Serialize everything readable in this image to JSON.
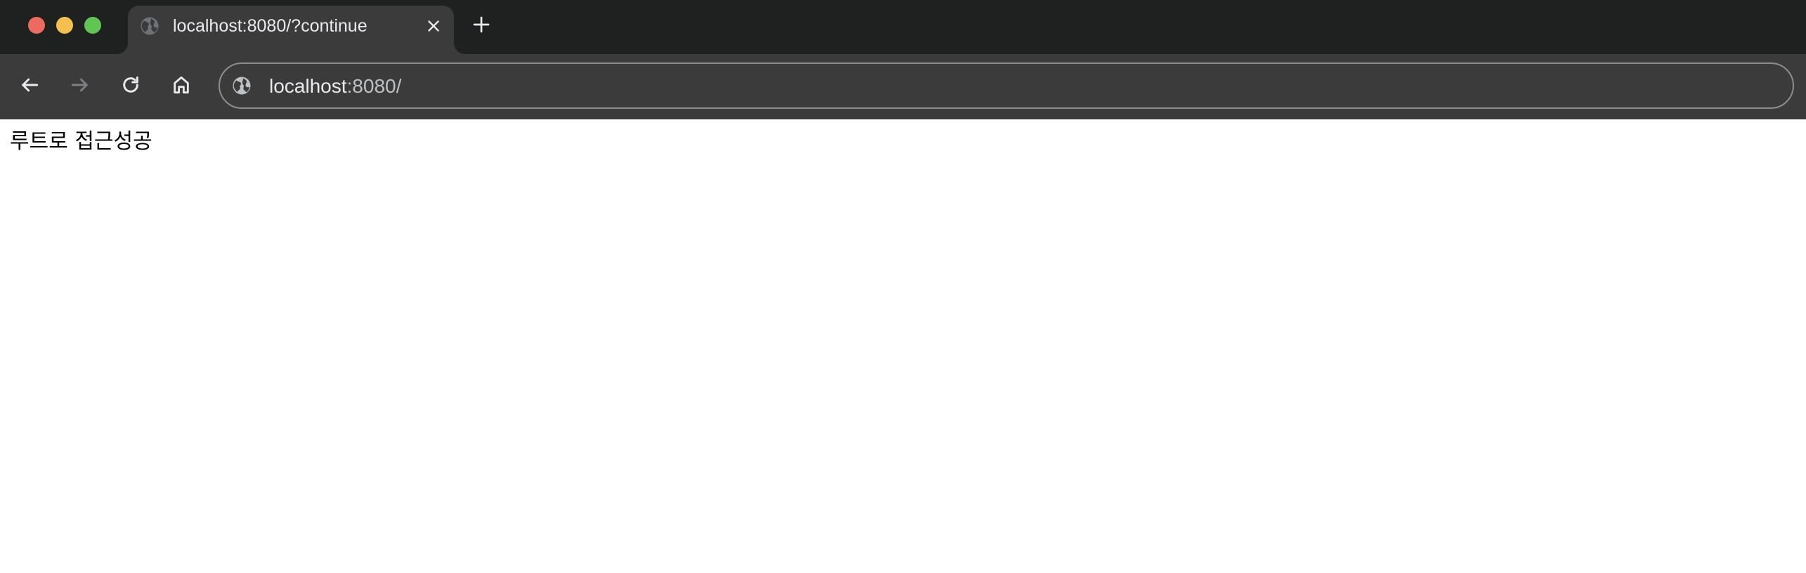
{
  "window": {
    "traffic_lights": [
      "close",
      "minimize",
      "maximize"
    ],
    "colors": {
      "close": "#ed6a5e",
      "minimize": "#f5bf4f",
      "maximize": "#61c554"
    }
  },
  "tabs": [
    {
      "title": "localhost:8080/?continue",
      "favicon": "globe-icon",
      "active": true
    }
  ],
  "toolbar": {
    "back_icon": "arrow-left-icon",
    "forward_icon": "arrow-right-icon",
    "reload_icon": "reload-icon",
    "home_icon": "home-icon",
    "omnibox": {
      "icon": "globe-icon",
      "host": "localhost",
      "rest": ":8080/"
    }
  },
  "page": {
    "body_text": "루트로 접근성공"
  }
}
